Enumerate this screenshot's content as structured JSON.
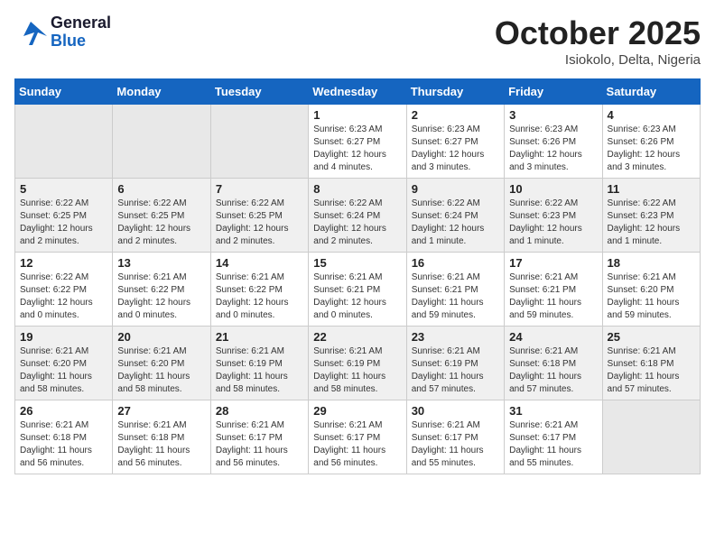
{
  "header": {
    "logo_general": "General",
    "logo_blue": "Blue",
    "month_title": "October 2025",
    "location": "Isiokolo, Delta, Nigeria"
  },
  "days_of_week": [
    "Sunday",
    "Monday",
    "Tuesday",
    "Wednesday",
    "Thursday",
    "Friday",
    "Saturday"
  ],
  "weeks": [
    [
      {
        "day": "",
        "info": ""
      },
      {
        "day": "",
        "info": ""
      },
      {
        "day": "",
        "info": ""
      },
      {
        "day": "1",
        "info": "Sunrise: 6:23 AM\nSunset: 6:27 PM\nDaylight: 12 hours\nand 4 minutes."
      },
      {
        "day": "2",
        "info": "Sunrise: 6:23 AM\nSunset: 6:27 PM\nDaylight: 12 hours\nand 3 minutes."
      },
      {
        "day": "3",
        "info": "Sunrise: 6:23 AM\nSunset: 6:26 PM\nDaylight: 12 hours\nand 3 minutes."
      },
      {
        "day": "4",
        "info": "Sunrise: 6:23 AM\nSunset: 6:26 PM\nDaylight: 12 hours\nand 3 minutes."
      }
    ],
    [
      {
        "day": "5",
        "info": "Sunrise: 6:22 AM\nSunset: 6:25 PM\nDaylight: 12 hours\nand 2 minutes."
      },
      {
        "day": "6",
        "info": "Sunrise: 6:22 AM\nSunset: 6:25 PM\nDaylight: 12 hours\nand 2 minutes."
      },
      {
        "day": "7",
        "info": "Sunrise: 6:22 AM\nSunset: 6:25 PM\nDaylight: 12 hours\nand 2 minutes."
      },
      {
        "day": "8",
        "info": "Sunrise: 6:22 AM\nSunset: 6:24 PM\nDaylight: 12 hours\nand 2 minutes."
      },
      {
        "day": "9",
        "info": "Sunrise: 6:22 AM\nSunset: 6:24 PM\nDaylight: 12 hours\nand 1 minute."
      },
      {
        "day": "10",
        "info": "Sunrise: 6:22 AM\nSunset: 6:23 PM\nDaylight: 12 hours\nand 1 minute."
      },
      {
        "day": "11",
        "info": "Sunrise: 6:22 AM\nSunset: 6:23 PM\nDaylight: 12 hours\nand 1 minute."
      }
    ],
    [
      {
        "day": "12",
        "info": "Sunrise: 6:22 AM\nSunset: 6:22 PM\nDaylight: 12 hours\nand 0 minutes."
      },
      {
        "day": "13",
        "info": "Sunrise: 6:21 AM\nSunset: 6:22 PM\nDaylight: 12 hours\nand 0 minutes."
      },
      {
        "day": "14",
        "info": "Sunrise: 6:21 AM\nSunset: 6:22 PM\nDaylight: 12 hours\nand 0 minutes."
      },
      {
        "day": "15",
        "info": "Sunrise: 6:21 AM\nSunset: 6:21 PM\nDaylight: 12 hours\nand 0 minutes."
      },
      {
        "day": "16",
        "info": "Sunrise: 6:21 AM\nSunset: 6:21 PM\nDaylight: 11 hours\nand 59 minutes."
      },
      {
        "day": "17",
        "info": "Sunrise: 6:21 AM\nSunset: 6:21 PM\nDaylight: 11 hours\nand 59 minutes."
      },
      {
        "day": "18",
        "info": "Sunrise: 6:21 AM\nSunset: 6:20 PM\nDaylight: 11 hours\nand 59 minutes."
      }
    ],
    [
      {
        "day": "19",
        "info": "Sunrise: 6:21 AM\nSunset: 6:20 PM\nDaylight: 11 hours\nand 58 minutes."
      },
      {
        "day": "20",
        "info": "Sunrise: 6:21 AM\nSunset: 6:20 PM\nDaylight: 11 hours\nand 58 minutes."
      },
      {
        "day": "21",
        "info": "Sunrise: 6:21 AM\nSunset: 6:19 PM\nDaylight: 11 hours\nand 58 minutes."
      },
      {
        "day": "22",
        "info": "Sunrise: 6:21 AM\nSunset: 6:19 PM\nDaylight: 11 hours\nand 58 minutes."
      },
      {
        "day": "23",
        "info": "Sunrise: 6:21 AM\nSunset: 6:19 PM\nDaylight: 11 hours\nand 57 minutes."
      },
      {
        "day": "24",
        "info": "Sunrise: 6:21 AM\nSunset: 6:18 PM\nDaylight: 11 hours\nand 57 minutes."
      },
      {
        "day": "25",
        "info": "Sunrise: 6:21 AM\nSunset: 6:18 PM\nDaylight: 11 hours\nand 57 minutes."
      }
    ],
    [
      {
        "day": "26",
        "info": "Sunrise: 6:21 AM\nSunset: 6:18 PM\nDaylight: 11 hours\nand 56 minutes."
      },
      {
        "day": "27",
        "info": "Sunrise: 6:21 AM\nSunset: 6:18 PM\nDaylight: 11 hours\nand 56 minutes."
      },
      {
        "day": "28",
        "info": "Sunrise: 6:21 AM\nSunset: 6:17 PM\nDaylight: 11 hours\nand 56 minutes."
      },
      {
        "day": "29",
        "info": "Sunrise: 6:21 AM\nSunset: 6:17 PM\nDaylight: 11 hours\nand 56 minutes."
      },
      {
        "day": "30",
        "info": "Sunrise: 6:21 AM\nSunset: 6:17 PM\nDaylight: 11 hours\nand 55 minutes."
      },
      {
        "day": "31",
        "info": "Sunrise: 6:21 AM\nSunset: 6:17 PM\nDaylight: 11 hours\nand 55 minutes."
      },
      {
        "day": "",
        "info": ""
      }
    ]
  ]
}
